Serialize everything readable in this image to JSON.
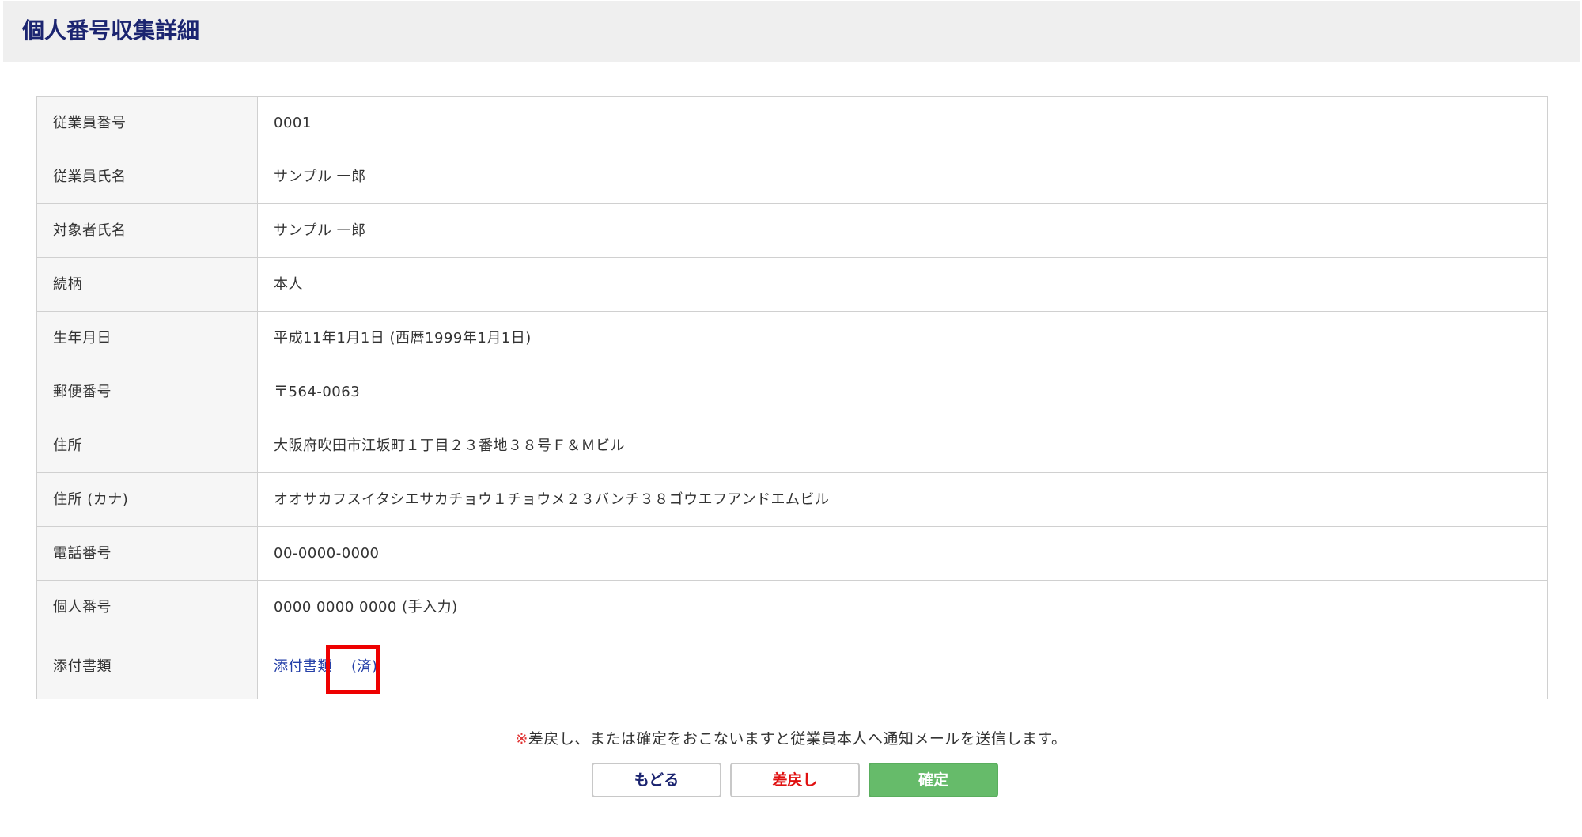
{
  "header": {
    "title": "個人番号収集詳細"
  },
  "details": {
    "rows": [
      {
        "label": "従業員番号",
        "value": "0001"
      },
      {
        "label": "従業員氏名",
        "value": "サンプル 一郎"
      },
      {
        "label": "対象者氏名",
        "value": "サンプル 一郎"
      },
      {
        "label": "続柄",
        "value": "本人"
      },
      {
        "label": "生年月日",
        "value": "平成11年1月1日 (西暦1999年1月1日)"
      },
      {
        "label": "郵便番号",
        "value": "〒564-0063"
      },
      {
        "label": "住所",
        "value": "大阪府吹田市江坂町１丁目２３番地３８号Ｆ＆Ｍビル"
      },
      {
        "label": "住所 (カナ)",
        "value": "オオサカフスイタシエサカチョウ１チョウメ２３バンチ３８ゴウエフアンドエムビル"
      },
      {
        "label": "電話番号",
        "value": "00-0000-0000"
      },
      {
        "label": "個人番号",
        "value": "0000 0000 0000 (手入力)"
      }
    ],
    "attachment": {
      "label": "添付書類",
      "link_text": "添付書類",
      "status": "(済)"
    }
  },
  "notice": {
    "mark": "※",
    "text": "差戻し、または確定をおこないますと従業員本人へ通知メールを送信します。"
  },
  "buttons": {
    "back": "もどる",
    "return": "差戻し",
    "confirm": "確定"
  },
  "colors": {
    "title": "#1b2470",
    "link": "#2540a8",
    "highlight": "#ee0000",
    "confirm_button": "#66bb6a",
    "return_text": "#e01010"
  }
}
